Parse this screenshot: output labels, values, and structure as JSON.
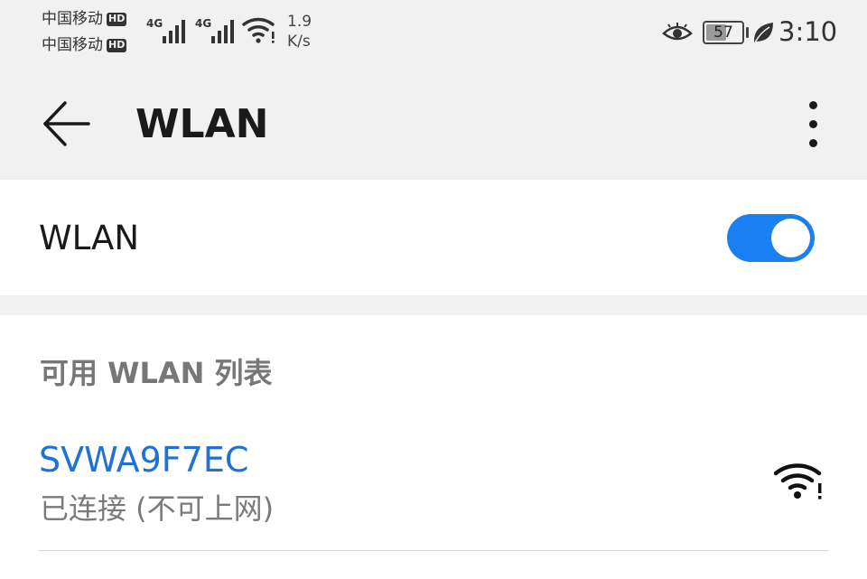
{
  "status_bar": {
    "carrier_1": "中国移动",
    "carrier_2": "中国移动",
    "hd_badge": "HD",
    "network_type": "4G",
    "speed_value": "1.9",
    "speed_unit": "K/s",
    "battery_level": "57",
    "time": "3:10",
    "icons": [
      "eye-comfort-icon",
      "battery-icon",
      "power-saving-leaf-icon",
      "wifi-no-internet-icon",
      "signal-icon"
    ]
  },
  "app_bar": {
    "title": "WLAN",
    "back_icon": "back-arrow-icon",
    "more_icon": "more-vertical-icon"
  },
  "wlan_toggle": {
    "label": "WLAN",
    "enabled": true,
    "accent_color": "#1a7ff0"
  },
  "available_list": {
    "header": "可用 WLAN 列表",
    "networks": [
      {
        "ssid": "SVWA9F7EC",
        "status": "已连接 (不可上网)",
        "icon": "wifi-no-internet-icon",
        "ssid_color": "#1d72d4"
      }
    ]
  }
}
